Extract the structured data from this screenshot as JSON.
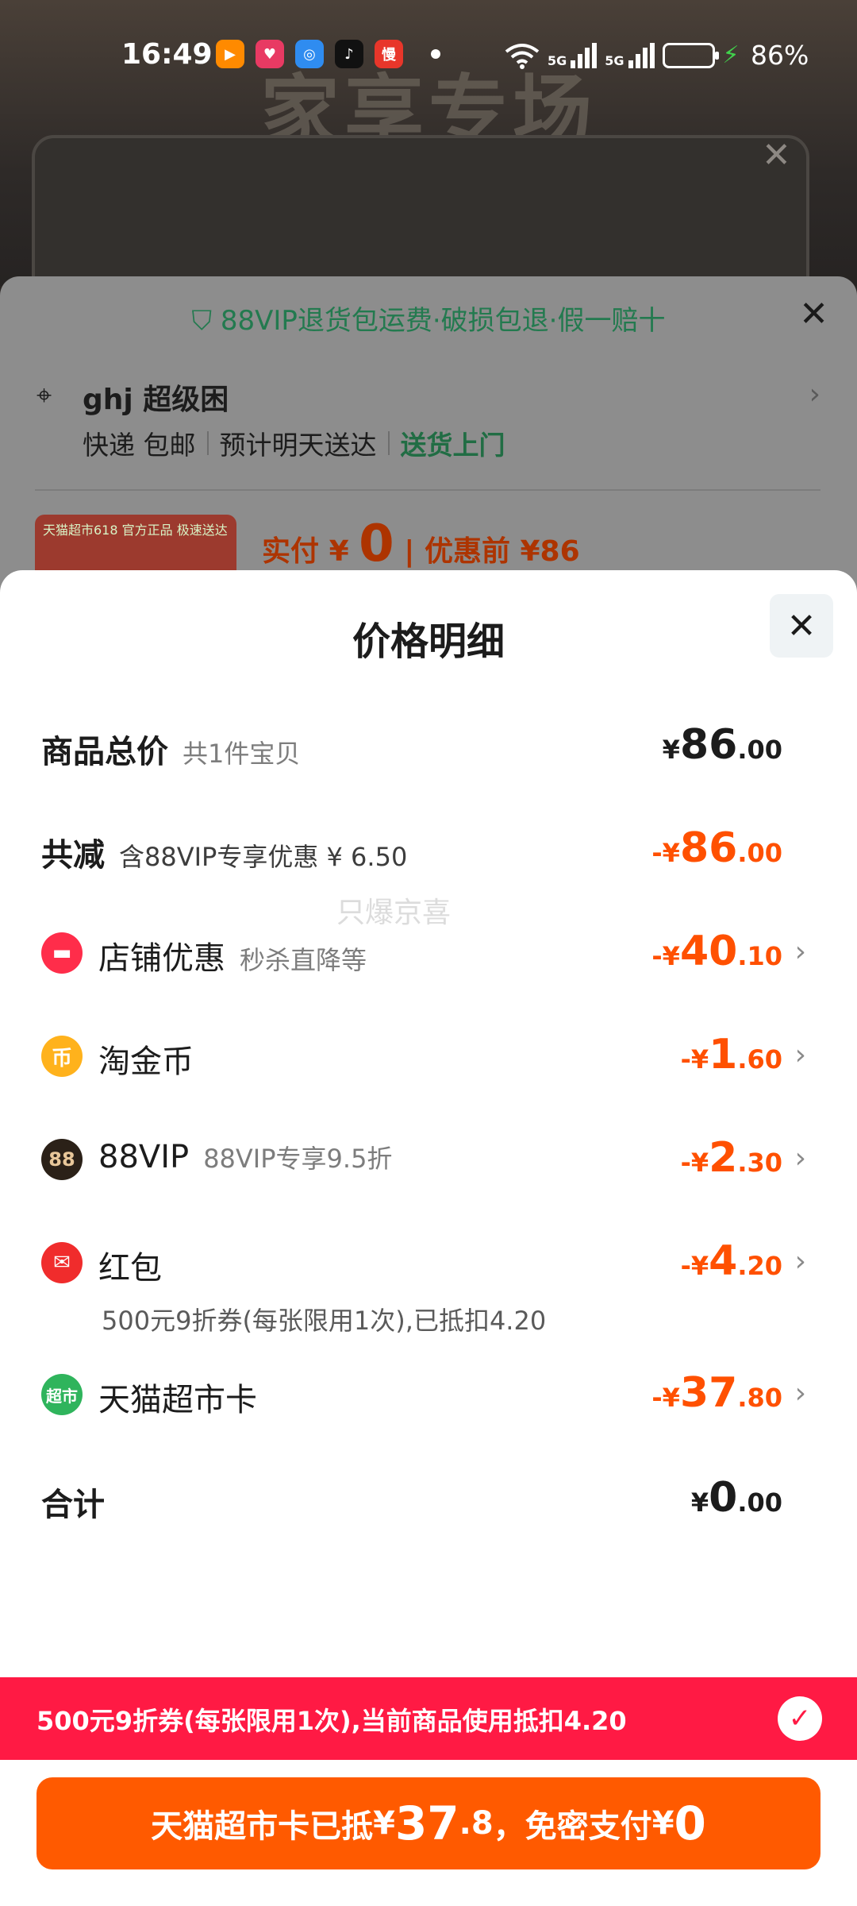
{
  "status_bar": {
    "time": "16:49",
    "battery": "86%",
    "network_labels": [
      "5G",
      "5G"
    ]
  },
  "background": {
    "promo_text": "家享专场"
  },
  "order_card": {
    "guarantee": "88VIP退货包运费·破损包退·假一赔十",
    "address_name": "ghj 超级困",
    "delivery": {
      "method": "快递 包邮",
      "eta": "预计明天送达",
      "door": "送货上门"
    },
    "pay_label": "实付",
    "pay_currency": "¥",
    "pay_amount": "0",
    "before_label": "优惠前 ¥86",
    "thumb_text": "天猫超市618 官方正品 极速送达"
  },
  "price_detail": {
    "title": "价格明细",
    "rows": [
      {
        "label": "商品总价",
        "sub": "共1件宝贝",
        "cur": "¥",
        "int": "86",
        "dec": ".00"
      },
      {
        "label": "共减",
        "sub": "含88VIP专享优惠 ¥ 6.50",
        "cur": "-¥",
        "int": "86",
        "dec": ".00"
      },
      {
        "label": "店铺优惠",
        "sub": "秒杀直降等",
        "cur": "-¥",
        "int": "40",
        "dec": ".10",
        "icon": "shop-icon"
      },
      {
        "label": "淘金币",
        "sub": "",
        "cur": "-¥",
        "int": "1",
        "dec": ".60",
        "icon": "coin-icon"
      },
      {
        "label": "88VIP",
        "sub": "88VIP专享9.5折",
        "cur": "-¥",
        "int": "2",
        "dec": ".30",
        "icon": "vip-icon"
      },
      {
        "label": "红包",
        "sub": "",
        "note": "500元9折券(每张限用1次),已抵扣4.20",
        "cur": "-¥",
        "int": "4",
        "dec": ".20",
        "icon": "red-packet-icon"
      },
      {
        "label": "天猫超市卡",
        "sub": "",
        "cur": "-¥",
        "int": "37",
        "dec": ".80",
        "icon": "supermarket-card-icon"
      },
      {
        "label": "合计",
        "sub": "",
        "cur": "¥",
        "int": "0",
        "dec": ".00"
      }
    ],
    "icon_glyphs": {
      "coin": "币",
      "vip": "88",
      "market": "超市"
    },
    "watermark": "只爆京喜"
  },
  "coupon_bar": {
    "text": "500元9折券(每张限用1次),当前商品使用抵扣4.20"
  },
  "pay_button": {
    "prefix": "天猫超市卡已抵",
    "cur1": "¥",
    "amount_int": "37",
    "amount_dec": ".8",
    "mid": "，免密支付",
    "cur2": "¥",
    "total": "0"
  },
  "colors": {
    "accent_orange": "#ff5000",
    "coupon_red": "#ff1a44",
    "green": "#216d44"
  }
}
